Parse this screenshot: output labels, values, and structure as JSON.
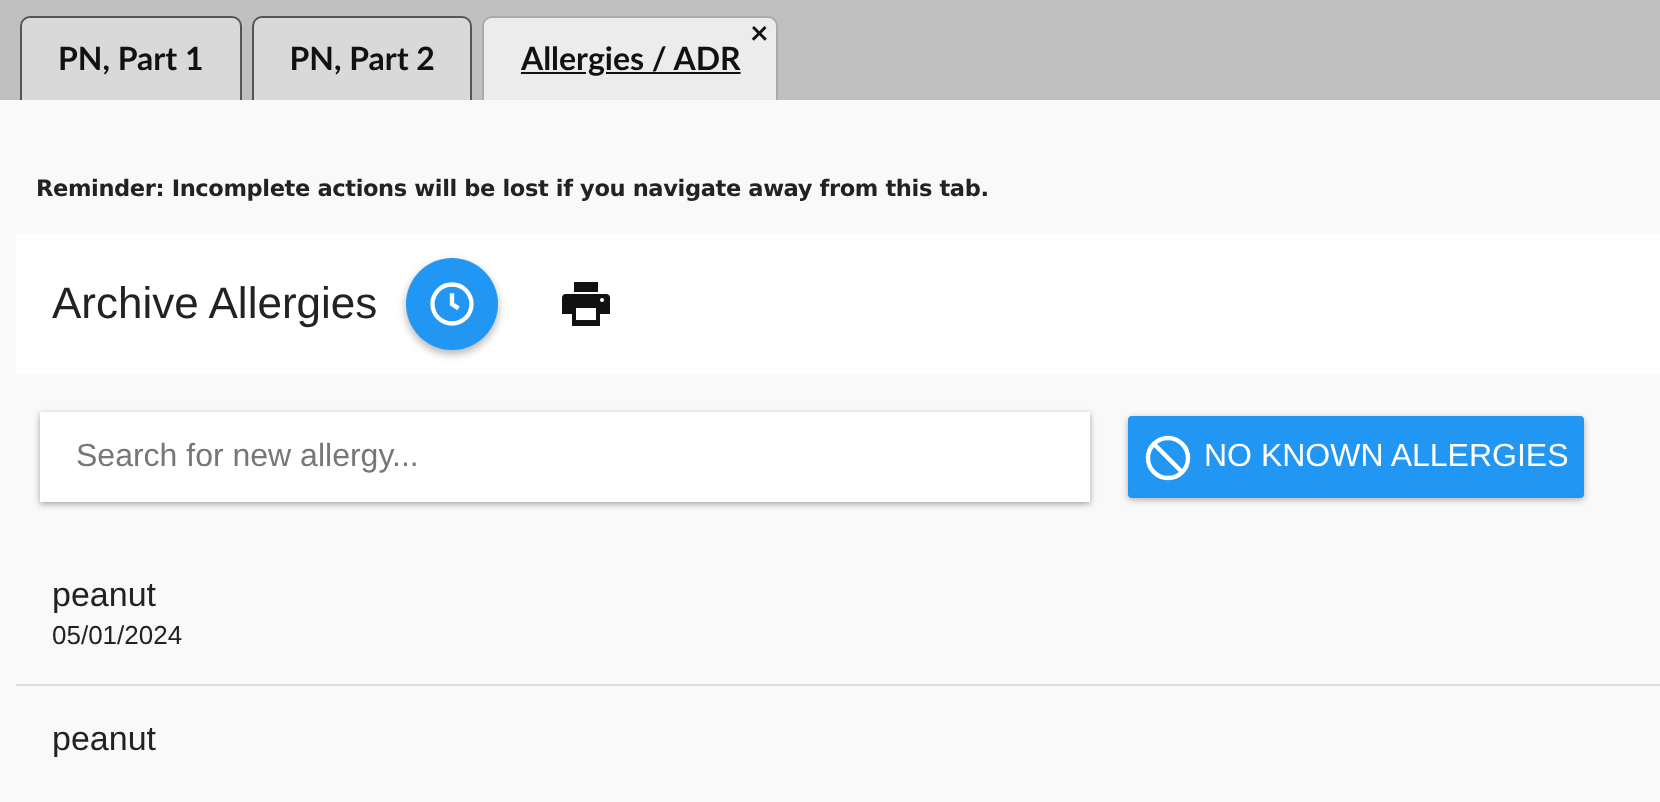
{
  "tabs": [
    {
      "label": "PN, Part 1",
      "selected": false
    },
    {
      "label": "PN, Part 2",
      "selected": false
    },
    {
      "label": "Allergies / ADR",
      "selected": true,
      "close": "×"
    }
  ],
  "reminder": "Reminder: Incomplete actions will be lost if you navigate away from this tab.",
  "header": {
    "title": "Archive Allergies"
  },
  "search": {
    "placeholder": "Search for new allergy..."
  },
  "no_known_button": {
    "label": "NO KNOWN ALLERGIES"
  },
  "allergies": [
    {
      "name": "peanut",
      "date": "05/01/2024"
    },
    {
      "name": "peanut"
    }
  ]
}
